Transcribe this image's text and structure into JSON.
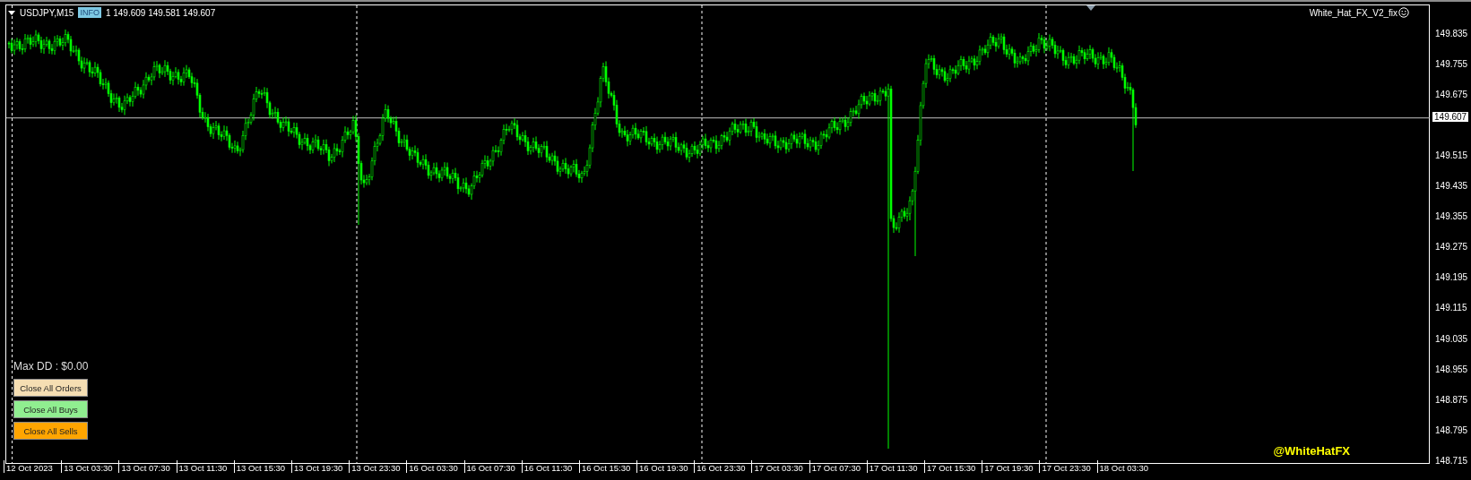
{
  "chart": {
    "symbol": "USDJPY,M15",
    "info_badge": "INFO",
    "ohlc": "1 149.609 149.581 149.607",
    "indicator": "White_Hat_FX_V2_fix",
    "max_dd": "Max DD : $0.00",
    "buttons": [
      {
        "label": "Close All Orders",
        "color": "#f5deb3"
      },
      {
        "label": "Close All Buys",
        "color": "#90ee90"
      },
      {
        "label": "Close All Sells",
        "color": "#ffa500"
      }
    ],
    "handle": "@WhiteHatFX"
  },
  "price_axis": {
    "labels": [
      "149.835",
      "149.755",
      "149.675",
      "149.515",
      "149.435",
      "149.355",
      "149.275",
      "149.195",
      "149.115",
      "149.035",
      "148.955",
      "148.875",
      "148.795",
      "148.715"
    ],
    "current_price": "149.607"
  },
  "time_axis": {
    "labels": [
      "12 Oct 2023",
      "13 Oct 03:30",
      "13 Oct 07:30",
      "13 Oct 11:30",
      "13 Oct 15:30",
      "13 Oct 19:30",
      "13 Oct 23:30",
      "16 Oct 03:30",
      "16 Oct 07:30",
      "16 Oct 11:30",
      "16 Oct 15:30",
      "16 Oct 19:30",
      "16 Oct 23:30",
      "17 Oct 03:30",
      "17 Oct 07:30",
      "17 Oct 11:30",
      "17 Oct 15:30",
      "17 Oct 19:30",
      "17 Oct 23:30",
      "18 Oct 03:30"
    ]
  }
}
